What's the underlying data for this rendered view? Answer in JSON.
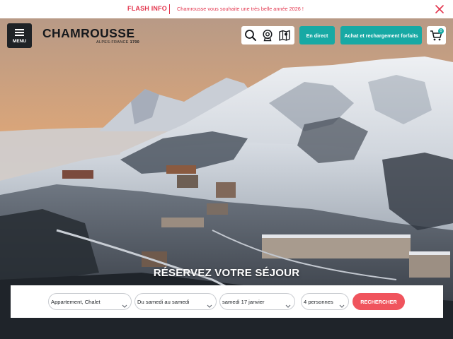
{
  "flash": {
    "label": "FLASH INFO",
    "message": "Chamrousse vous souhaite une très belle année 2026 !"
  },
  "header": {
    "menu_label": "MENU",
    "logo_text": "CHAMROUSSE",
    "logo_sub_region": "ALPES-FRANCE",
    "logo_sub_altitude": "1700",
    "live_label": "En direct",
    "pass_label": "Achat et rechargement forfaits",
    "cart_count": "0",
    "tool_icons": [
      "search-icon",
      "webcam-icon",
      "map-icon"
    ]
  },
  "booking": {
    "title": "RÉSERVEZ VOTRE SÉJOUR",
    "accommodation": "Appartement, Chalet",
    "period": "Du samedi au samedi",
    "date": "samedi 17 janvier",
    "guests": "4 personnes",
    "search_label": "RECHERCHER"
  },
  "colors": {
    "accent_teal": "#17a9a4",
    "flash_red": "#e3354d",
    "search_red": "#f0545d",
    "menu_dark": "#1e2226"
  }
}
